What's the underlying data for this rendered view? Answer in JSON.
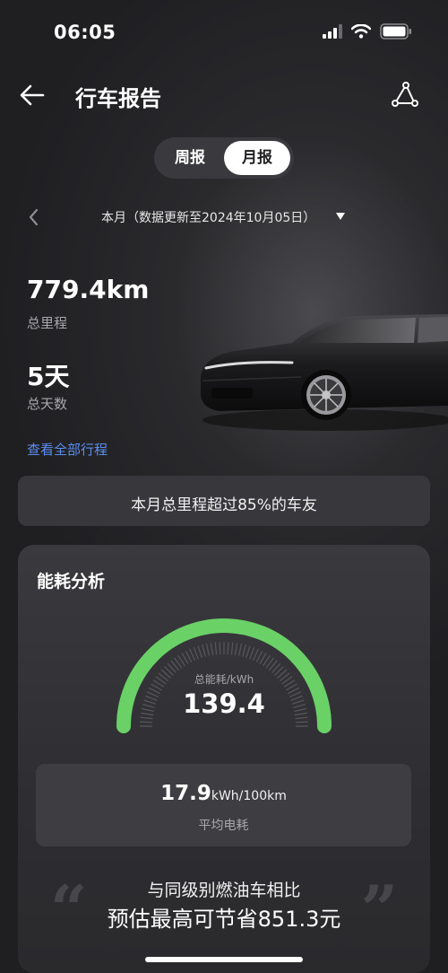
{
  "status_bar": {
    "time": "06:05",
    "icons": [
      "signal-icon",
      "wifi-icon",
      "battery-icon"
    ]
  },
  "nav": {
    "title": "行车报告",
    "back_icon": "arrow-left-icon",
    "route_icon": "route-icon"
  },
  "segment": {
    "week": "周报",
    "month": "月报",
    "selected": "month"
  },
  "period": {
    "text": "本月（数据更新至2024年10月05日）"
  },
  "stats": {
    "mileage_value": "779.4km",
    "mileage_label": "总里程",
    "days_value": "5天",
    "days_label": "总天数",
    "all_trips_link": "查看全部行程"
  },
  "comparison": {
    "text": "本月总里程超过85%的车友"
  },
  "energy": {
    "title": "能耗分析",
    "gauge_label": "总能耗/kWh",
    "gauge_value": "139.4",
    "gauge_fraction": 1.0,
    "avg_value": "17.9",
    "avg_unit": "kWh/100km",
    "avg_label": "平均电耗",
    "saving_line1": "与同级别燃油车相比",
    "saving_line2": "预估最高可节省851.3元"
  },
  "colors": {
    "accent_blue": "#5b8df0",
    "gauge_green": "#6ad167",
    "background": "#1f1f22"
  }
}
